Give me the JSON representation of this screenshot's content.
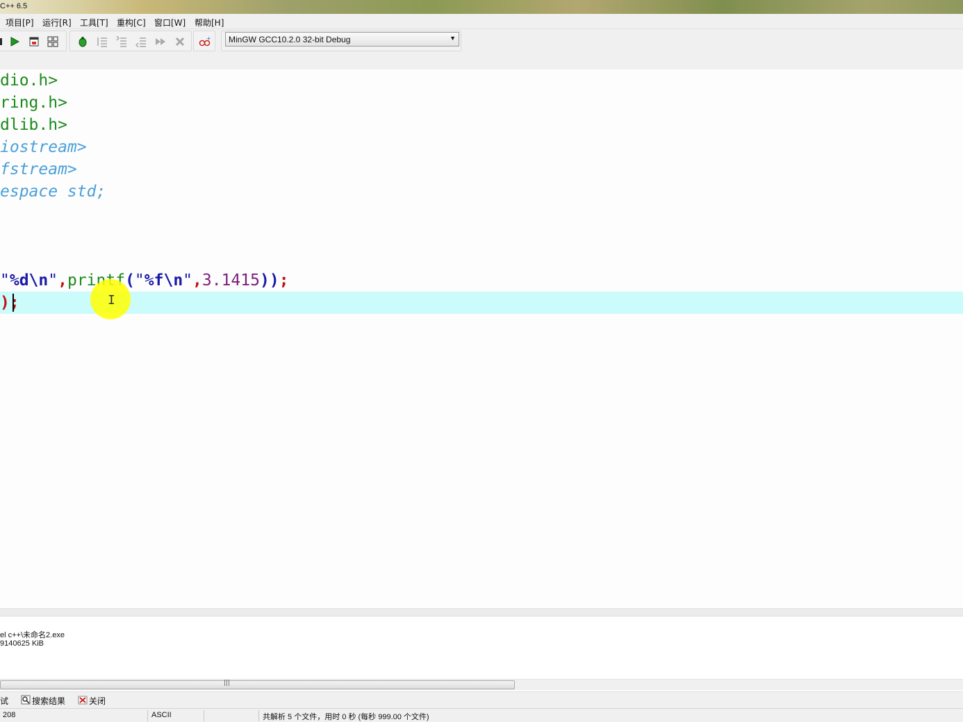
{
  "window": {
    "title": "C++ 6.5"
  },
  "menu": {
    "items": [
      "项目[P]",
      "运行[R]",
      "工具[T]",
      "重构[C]",
      "窗口[W]",
      "帮助[H]"
    ]
  },
  "toolbar": {
    "compiler_selected": "MinGW GCC10.2.0 32-bit Debug"
  },
  "editor": {
    "lines": [
      {
        "segments": [
          {
            "text": "dio.h>",
            "style": "green"
          }
        ]
      },
      {
        "segments": [
          {
            "text": "ring.h>",
            "style": "green"
          }
        ]
      },
      {
        "segments": [
          {
            "text": "dlib.h>",
            "style": "green"
          }
        ]
      },
      {
        "segments": [
          {
            "text": "iostream>",
            "style": "italic-blue"
          }
        ]
      },
      {
        "segments": [
          {
            "text": "fstream>",
            "style": "italic-blue"
          }
        ]
      },
      {
        "segments": [
          {
            "text": "espace std;",
            "style": "italic-blue"
          }
        ]
      },
      {
        "segments": []
      },
      {
        "segments": []
      },
      {
        "segments": []
      },
      {
        "segments": [
          {
            "text": "\"",
            "style": "str"
          },
          {
            "text": "%d\\n",
            "style": "navy"
          },
          {
            "text": "\"",
            "style": "str"
          },
          {
            "text": ",",
            "style": "red"
          },
          {
            "text": "printf",
            "style": "func"
          },
          {
            "text": "(",
            "style": "navy"
          },
          {
            "text": "\"",
            "style": "str"
          },
          {
            "text": "%f\\n",
            "style": "navy"
          },
          {
            "text": "\"",
            "style": "str"
          },
          {
            "text": ",",
            "style": "red"
          },
          {
            "text": "3.1415",
            "style": "num"
          },
          {
            "text": "))",
            "style": "navy"
          },
          {
            "text": ";",
            "style": "red"
          }
        ]
      },
      {
        "segments": [
          {
            "text": ")",
            "style": "red"
          },
          {
            "text": ";",
            "style": "red"
          }
        ]
      }
    ]
  },
  "output": {
    "line1": "el c++\\未命名2.exe",
    "line2": "9140625 KiB"
  },
  "bottom_tabs": [
    {
      "label": "试",
      "icon": "debug-icon"
    },
    {
      "label": "搜索结果",
      "icon": "search-icon"
    },
    {
      "label": "关闭",
      "icon": "close-icon"
    }
  ],
  "status": {
    "line": "208",
    "encoding": "ASCII",
    "message": "共解析 5 个文件，用时 0 秒 (每秒 999.00 个文件)"
  },
  "colors": {
    "current_line": "#ccfbfb",
    "include_green": "#1b8a1b",
    "keyword_blue": "#4a9fd8",
    "operator_red": "#c01010"
  }
}
